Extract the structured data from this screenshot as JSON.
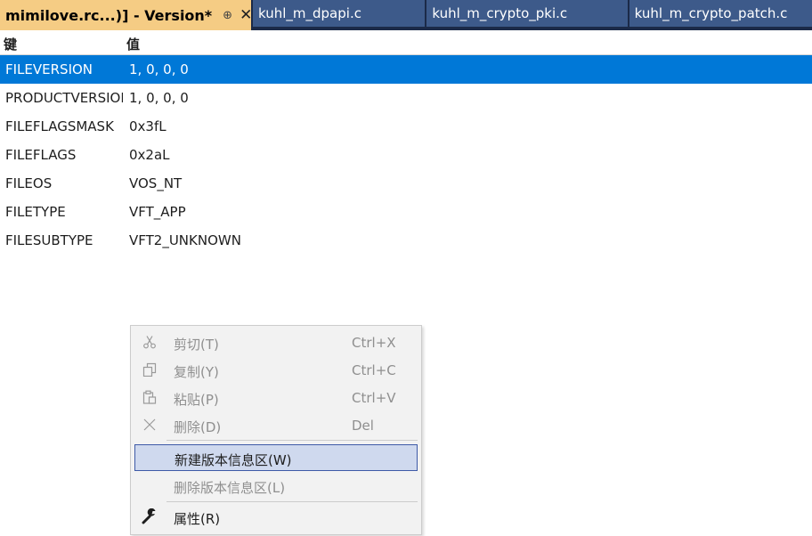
{
  "tabs": {
    "active": {
      "title": "mimilove.rc...)] - Version*",
      "pin": "⊕",
      "close": "✕"
    },
    "others": [
      "kuhl_m_dpapi.c",
      "kuhl_m_crypto_pki.c",
      "kuhl_m_crypto_patch.c"
    ]
  },
  "table": {
    "headers": {
      "key": "键",
      "value": "值"
    },
    "rows": [
      {
        "key": "FILEVERSION",
        "value": "1, 0, 0, 0"
      },
      {
        "key": "PRODUCTVERSION",
        "value": "1, 0, 0, 0"
      },
      {
        "key": "FILEFLAGSMASK",
        "value": "0x3fL"
      },
      {
        "key": "FILEFLAGS",
        "value": "0x2aL"
      },
      {
        "key": "FILEOS",
        "value": "VOS_NT"
      },
      {
        "key": "FILETYPE",
        "value": "VFT_APP"
      },
      {
        "key": "FILESUBTYPE",
        "value": "VFT2_UNKNOWN"
      }
    ]
  },
  "context_menu": {
    "items": [
      {
        "label": "剪切(T)",
        "shortcut": "Ctrl+X",
        "icon": "scissors-icon"
      },
      {
        "label": "复制(Y)",
        "shortcut": "Ctrl+C",
        "icon": "copy-icon"
      },
      {
        "label": "粘贴(P)",
        "shortcut": "Ctrl+V",
        "icon": "paste-icon"
      },
      {
        "label": "删除(D)",
        "shortcut": "Del",
        "icon": "delete-icon"
      },
      {
        "label": "新建版本信息区(W)"
      },
      {
        "label": "删除版本信息区(L)"
      },
      {
        "label": "属性(R)",
        "icon": "wrench-icon"
      }
    ]
  },
  "colors": {
    "selection": "#0078d7",
    "active_tab": "#f5cc84",
    "tabbar": "#1b2a48",
    "menu_hover": "#cfd9ee"
  }
}
